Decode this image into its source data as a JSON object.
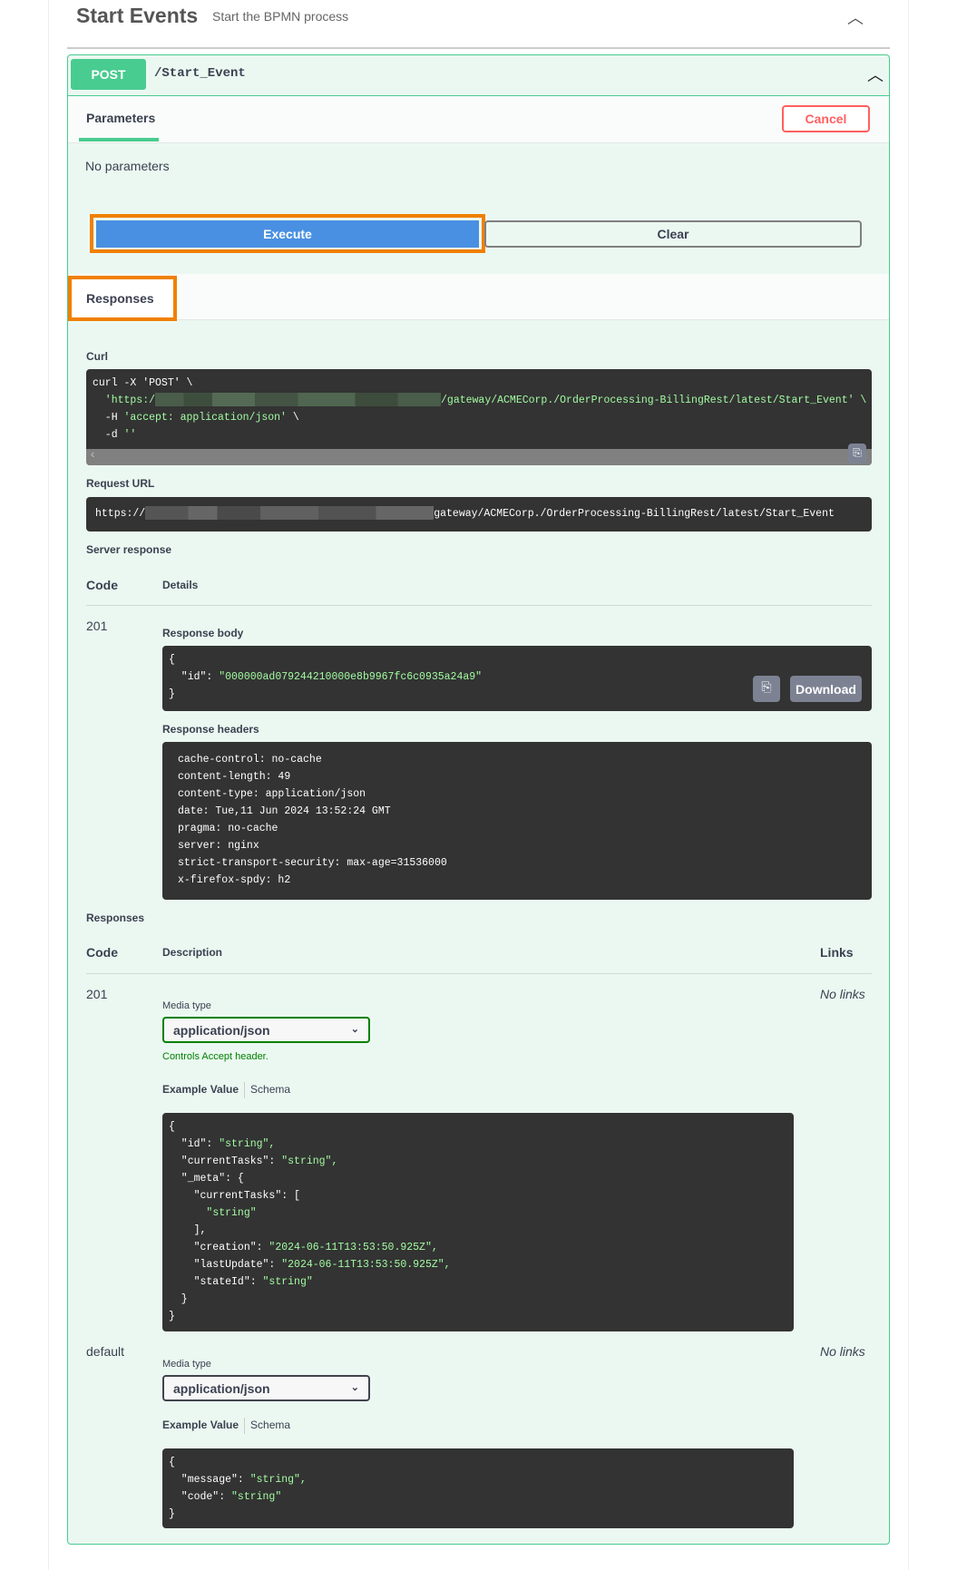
{
  "header": {
    "title": "Start Events",
    "subtitle": "Start the BPMN process"
  },
  "operation": {
    "method": "POST",
    "path": "/Start_Event",
    "method_color": "#49cc90",
    "tab_parameters": "Parameters",
    "cancel_label": "Cancel",
    "no_parameters": "No parameters",
    "execute_label": "Execute",
    "clear_label": "Clear",
    "responses_tab": "Responses"
  },
  "curl": {
    "label": "Curl",
    "line1": "curl -X 'POST' \\",
    "line2_prefix": "  'https:/",
    "line2_suffix": "/gateway/ACMECorp./OrderProcessing-BillingRest/latest/Start_Event' \\",
    "line3_a": "  -H ",
    "line3_b": "'accept: application/json'",
    "line3_c": " \\",
    "line4_a": "  -d ",
    "line4_b": "''"
  },
  "request_url": {
    "label": "Request URL",
    "prefix": "https://",
    "suffix": "gateway/ACMECorp./OrderProcessing-BillingRest/latest/Start_Event"
  },
  "server_response": {
    "label": "Server response",
    "code_header": "Code",
    "details_header": "Details",
    "code": "201",
    "body_label": "Response body",
    "body_open": "{",
    "body_key": "  \"id\": ",
    "body_value": "\"000000ad079244210000e8b9967fc6c0935a24a9\"",
    "body_close": "}",
    "download_label": "Download",
    "headers_label": "Response headers",
    "headers": [
      "cache-control: no-cache",
      "content-length: 49",
      "content-type: application/json",
      "date: Tue,11 Jun 2024 13:52:24 GMT",
      "pragma: no-cache",
      "server: nginx",
      "strict-transport-security: max-age=31536000",
      "x-firefox-spdy: h2"
    ]
  },
  "responses": {
    "label": "Responses",
    "code_header": "Code",
    "description_header": "Description",
    "links_header": "Links",
    "items": [
      {
        "code": "201",
        "media_type_label": "Media type",
        "media_type": "application/json",
        "controls": "Controls Accept header.",
        "example_tab": "Example Value",
        "schema_tab": "Schema",
        "links": "No links",
        "example": [
          [
            "{",
            ""
          ],
          [
            "  \"id\": ",
            "\"string\","
          ],
          [
            "  \"currentTasks\": ",
            "\"string\","
          ],
          [
            "  \"_meta\": {",
            ""
          ],
          [
            "    \"currentTasks\": [",
            ""
          ],
          [
            "      ",
            "\"string\""
          ],
          [
            "    ],",
            ""
          ],
          [
            "    \"creation\": ",
            "\"2024-06-11T13:53:50.925Z\","
          ],
          [
            "    \"lastUpdate\": ",
            "\"2024-06-11T13:53:50.925Z\","
          ],
          [
            "    \"stateId\": ",
            "\"string\""
          ],
          [
            "  }",
            ""
          ],
          [
            "}",
            ""
          ]
        ]
      },
      {
        "code": "default",
        "media_type_label": "Media type",
        "media_type": "application/json",
        "example_tab": "Example Value",
        "schema_tab": "Schema",
        "links": "No links",
        "example": [
          [
            "{",
            ""
          ],
          [
            "  \"message\": ",
            "\"string\","
          ],
          [
            "  \"code\": ",
            "\"string\""
          ],
          [
            "}",
            ""
          ]
        ]
      }
    ]
  }
}
